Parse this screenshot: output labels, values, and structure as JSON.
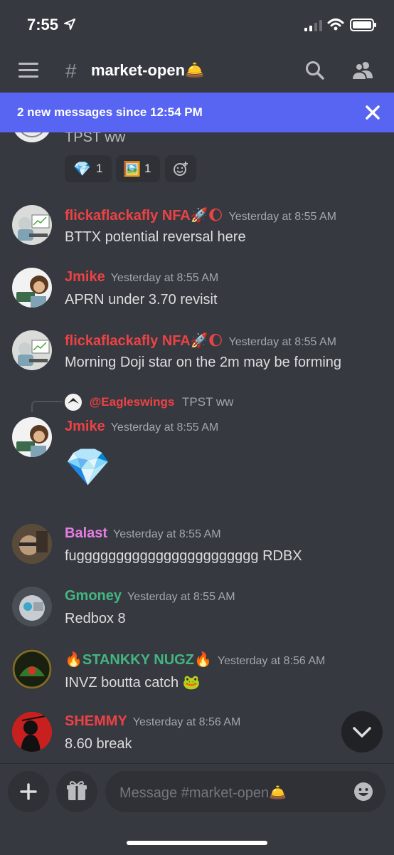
{
  "status": {
    "time": "7:55"
  },
  "header": {
    "hash": "#",
    "channel": "market-open🛎️"
  },
  "banner": {
    "text": "2 new messages since 12:54 PM"
  },
  "messages": [
    {
      "content": "TPST ww",
      "reactions": [
        {
          "emoji": "💎",
          "count": "1"
        },
        {
          "emoji": "🖼️",
          "count": "1"
        }
      ]
    },
    {
      "author": "flickaflackafly NFA🚀🌔",
      "timestamp": "Yesterday at 8:55 AM",
      "content": "BTTX potential reversal here",
      "author_color": "#ed4245"
    },
    {
      "author": "Jmike",
      "timestamp": "Yesterday at 8:55 AM",
      "content": "APRN under 3.70 revisit",
      "author_color": "#ed4245"
    },
    {
      "author": "flickaflackafly NFA🚀🌔",
      "timestamp": "Yesterday at 8:55 AM",
      "content": "Morning Doji star on the 2m may be forming",
      "author_color": "#ed4245"
    },
    {
      "reply_to": "@Eagleswings",
      "reply_text": "TPST ww",
      "author": "Jmike",
      "timestamp": "Yesterday at 8:55 AM",
      "content": "💎",
      "author_color": "#ed4245"
    },
    {
      "author": "Balast",
      "timestamp": "Yesterday at 8:55 AM",
      "content": "fuggggggggggggggggggggggg RDBX",
      "author_color": "#e67de5"
    },
    {
      "author": "Gmoney",
      "timestamp": "Yesterday at 8:55 AM",
      "content": "Redbox 8",
      "author_color": "#43b581"
    },
    {
      "author": "🔥STANKKY NUGZ🔥",
      "timestamp": "Yesterday at 8:56 AM",
      "content": "INVZ boutta catch 🐸",
      "author_color": "#43b581"
    },
    {
      "author": "SHEMMY",
      "timestamp": "Yesterday at 8:56 AM",
      "content": "8.60 break",
      "author_color": "#ed4245"
    }
  ],
  "composer": {
    "placeholder": "Message #market-open🛎️"
  }
}
